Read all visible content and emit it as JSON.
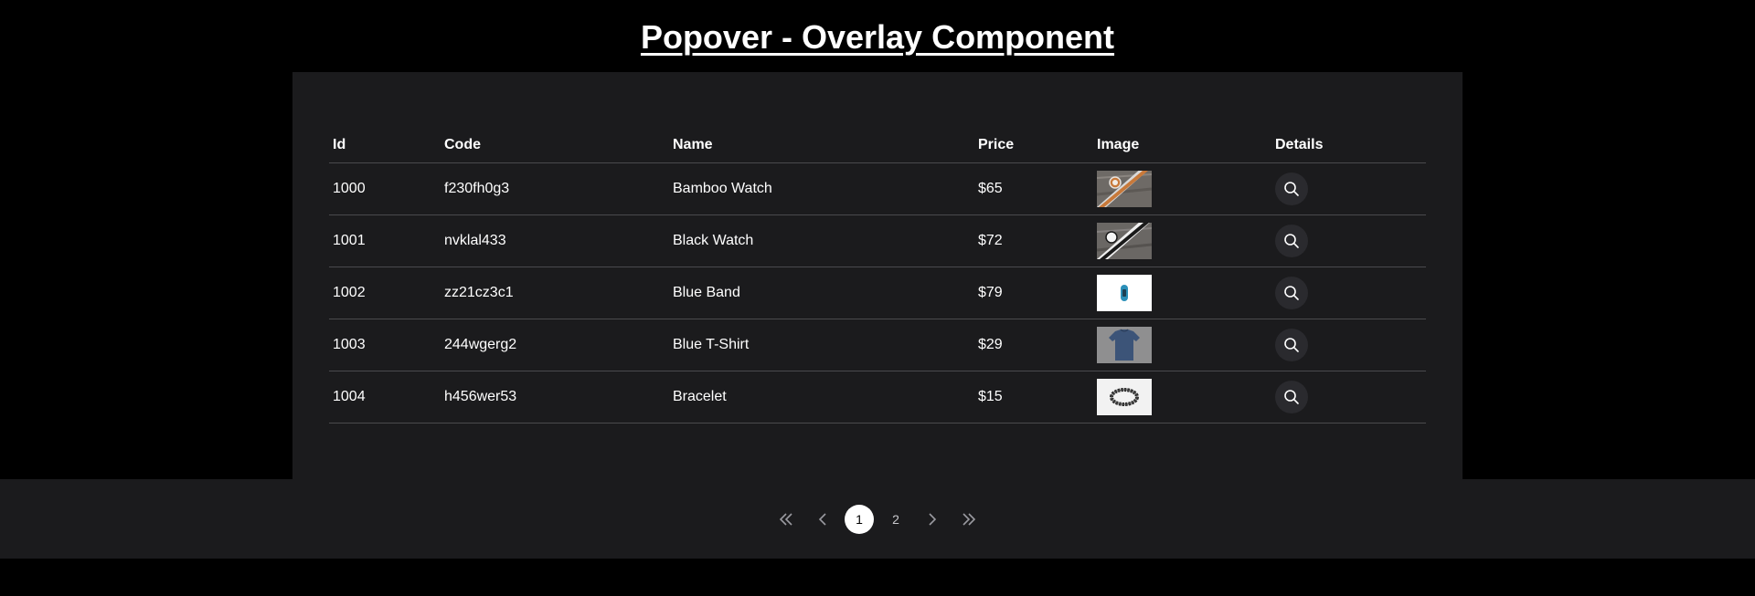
{
  "title": "Popover - Overlay Component",
  "table": {
    "headers": {
      "id": "Id",
      "code": "Code",
      "name": "Name",
      "price": "Price",
      "image": "Image",
      "details": "Details"
    },
    "rows": [
      {
        "id": "1000",
        "code": "f230fh0g3",
        "name": "Bamboo Watch",
        "price": "$65",
        "image": "bamboo-watch-thumbnail"
      },
      {
        "id": "1001",
        "code": "nvklal433",
        "name": "Black Watch",
        "price": "$72",
        "image": "black-watch-thumbnail"
      },
      {
        "id": "1002",
        "code": "zz21cz3c1",
        "name": "Blue Band",
        "price": "$79",
        "image": "blue-band-thumbnail"
      },
      {
        "id": "1003",
        "code": "244wgerg2",
        "name": "Blue T-Shirt",
        "price": "$29",
        "image": "blue-t-shirt-thumbnail"
      },
      {
        "id": "1004",
        "code": "h456wer53",
        "name": "Bracelet",
        "price": "$15",
        "image": "bracelet-thumbnail"
      }
    ],
    "details_icon": "search-icon"
  },
  "paginator": {
    "first_icon": "double-chevron-left-icon",
    "prev_icon": "chevron-left-icon",
    "pages": [
      "1",
      "2"
    ],
    "current_page": "1",
    "next_icon": "chevron-right-icon",
    "last_icon": "double-chevron-right-icon"
  },
  "colors": {
    "background": "#000000",
    "card": "#1b1b1d",
    "divider": "#4a4a4d",
    "text": "#ffffff",
    "active_page": "#ffffff"
  }
}
